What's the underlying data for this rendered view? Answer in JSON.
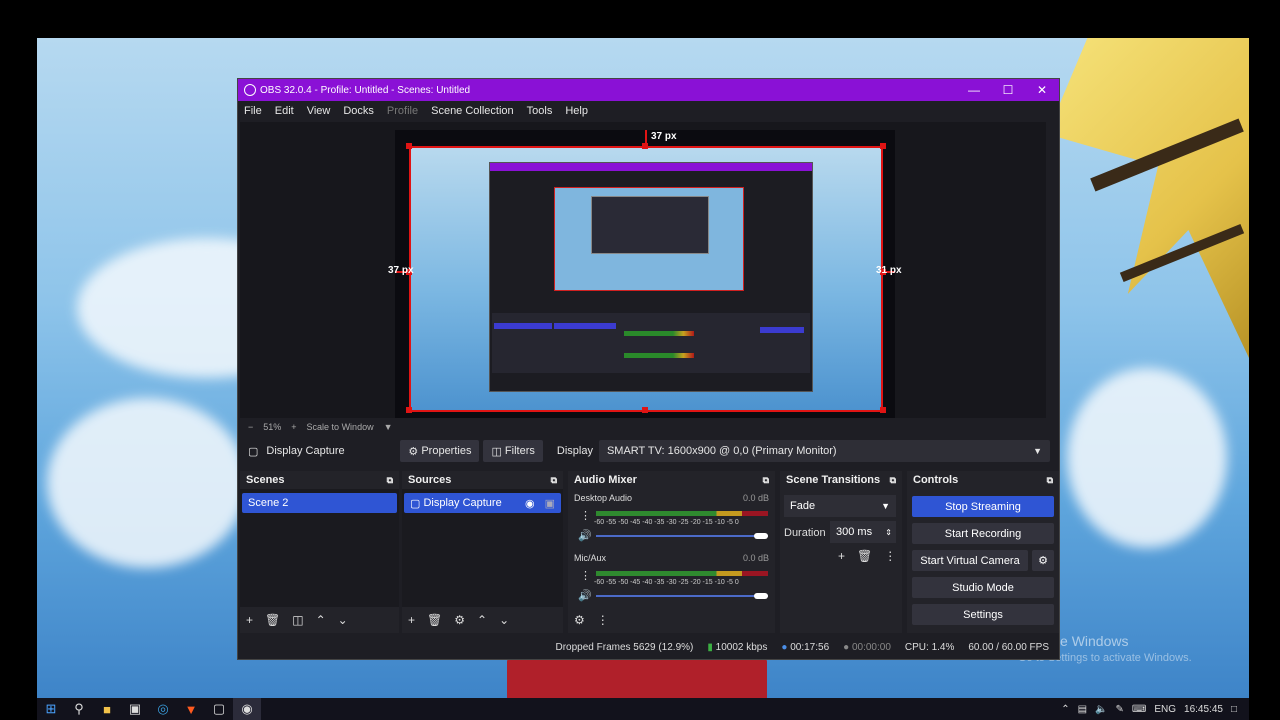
{
  "window": {
    "title": "OBS 32.0.4 - Profile: Untitled - Scenes: Untitled"
  },
  "menu": [
    "File",
    "Edit",
    "View",
    "Docks",
    "Profile",
    "Scene Collection",
    "Tools",
    "Help"
  ],
  "preview": {
    "measure_top": "37 px",
    "measure_left": "37 px",
    "measure_right": "31 px",
    "zoom": "51%",
    "scale_mode": "Scale to Window"
  },
  "source_toolbar": {
    "source_name": "Display Capture",
    "properties_label": "Properties",
    "filters_label": "Filters",
    "display_label": "Display",
    "display_value": "SMART TV: 1600x900 @ 0,0 (Primary Monitor)"
  },
  "scenes": {
    "title": "Scenes",
    "items": [
      "Scene 2"
    ]
  },
  "sources": {
    "title": "Sources",
    "items": [
      "Display Capture"
    ]
  },
  "mixer": {
    "title": "Audio Mixer",
    "tracks": [
      {
        "name": "Desktop Audio",
        "db": "0.0 dB",
        "volume": 1.0
      },
      {
        "name": "Mic/Aux",
        "db": "0.0 dB",
        "volume": 1.0
      }
    ],
    "ticks": "-60 -55 -50 -45 -40 -35 -30 -25 -20 -15 -10 -5 0"
  },
  "transitions": {
    "title": "Scene Transitions",
    "type": "Fade",
    "duration_label": "Duration",
    "duration_value": "300 ms"
  },
  "controls": {
    "title": "Controls",
    "stop_streaming": "Stop Streaming",
    "start_recording": "Start Recording",
    "start_virtual_camera": "Start Virtual Camera",
    "studio_mode": "Studio Mode",
    "settings": "Settings"
  },
  "status": {
    "dropped": "Dropped Frames 5629 (12.9%)",
    "bitrate": "10002 kbps",
    "stream_time": "00:17:56",
    "record_time": "00:00:00",
    "cpu": "CPU: 1.4%",
    "fps": "60.00 / 60.00 FPS"
  },
  "desktop": {
    "watermark_title": "Activate Windows",
    "watermark_sub": "Go to Settings to activate Windows.",
    "tray_lang": "ENG",
    "clock": "16:45:45"
  }
}
